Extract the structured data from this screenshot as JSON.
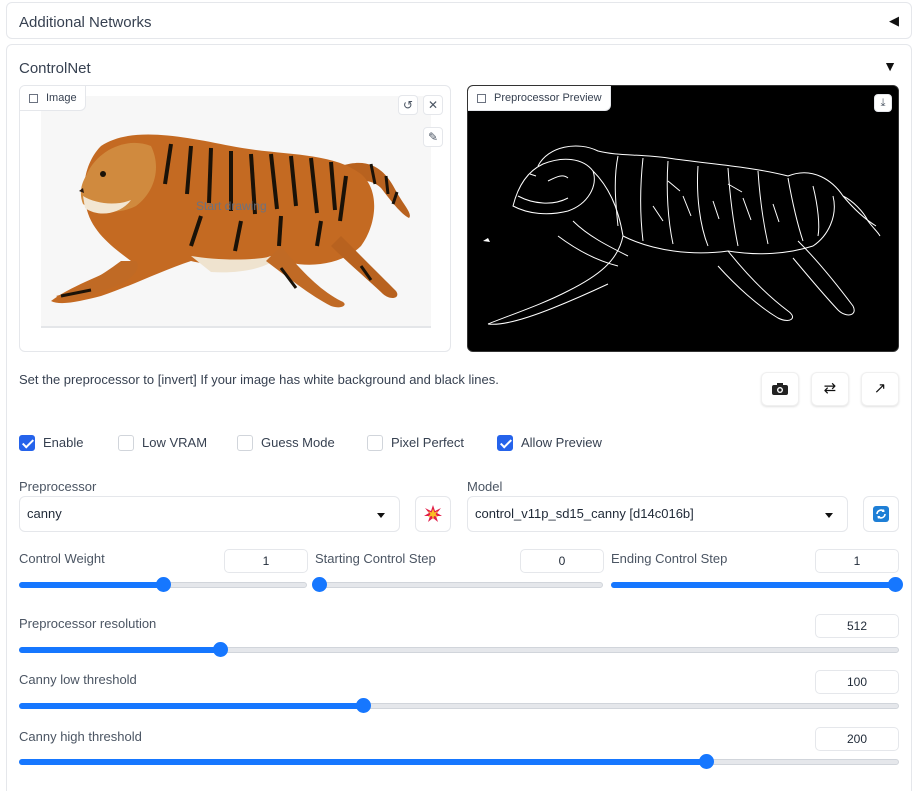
{
  "additional_networks": {
    "title": "Additional Networks",
    "arrow": "◀"
  },
  "controlnet": {
    "title": "ControlNet",
    "arrow": "▼",
    "image_panel": {
      "label": "Image",
      "overlay_text": "Start drawing"
    },
    "preview_panel": {
      "label": "Preprocessor Preview"
    },
    "help_text": "Set the preprocessor to [invert] If your image has white background and black lines.",
    "checkboxes": [
      {
        "label": "Enable",
        "checked": true
      },
      {
        "label": "Low VRAM",
        "checked": false
      },
      {
        "label": "Guess Mode",
        "checked": false
      },
      {
        "label": "Pixel Perfect",
        "checked": false
      },
      {
        "label": "Allow Preview",
        "checked": true
      }
    ],
    "preprocessor": {
      "label": "Preprocessor",
      "value": "canny"
    },
    "model": {
      "label": "Model",
      "value": "control_v11p_sd15_canny [d14c016b]"
    },
    "control_weight": {
      "label": "Control Weight",
      "value": "1",
      "min": 0,
      "max": 2,
      "level": 1
    },
    "starting_step": {
      "label": "Starting Control Step",
      "value": "0",
      "min": 0,
      "max": 1,
      "level": 0
    },
    "ending_step": {
      "label": "Ending Control Step",
      "value": "1",
      "min": 0,
      "max": 1,
      "level": 1
    },
    "preprocessor_resolution": {
      "label": "Preprocessor resolution",
      "value": "512",
      "min": 64,
      "max": 2048,
      "level": 512
    },
    "canny_low": {
      "label": "Canny low threshold",
      "value": "100",
      "min": 1,
      "max": 255,
      "level": 100
    },
    "canny_high": {
      "label": "Canny high threshold",
      "value": "200",
      "min": 1,
      "max": 255,
      "level": 200
    }
  },
  "colors": {
    "accent": "#1677ff",
    "checkbox": "#2563eb"
  }
}
